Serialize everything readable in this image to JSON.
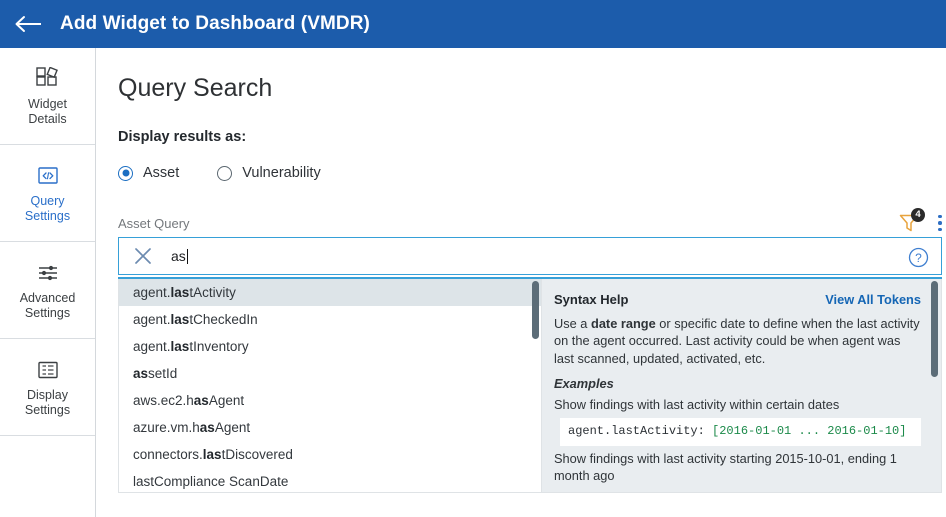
{
  "header": {
    "title": "Add Widget to Dashboard (VMDR)",
    "back_icon": "back-arrow-icon"
  },
  "sidebar": {
    "items": [
      {
        "label": "Widget\nDetails",
        "icon": "widgets-icon",
        "active": false
      },
      {
        "label": "Query\nSettings",
        "icon": "code-icon",
        "active": true
      },
      {
        "label": "Advanced\nSettings",
        "icon": "sliders-icon",
        "active": false
      },
      {
        "label": "Display\nSettings",
        "icon": "display-icon",
        "active": false
      }
    ]
  },
  "main": {
    "page_title": "Query Search",
    "display_results_label": "Display results as:",
    "radios": [
      {
        "label": "Asset",
        "selected": true
      },
      {
        "label": "Vulnerability",
        "selected": false
      }
    ],
    "query_field": {
      "label": "Asset Query",
      "value": "as",
      "clear_icon": "close-x-icon",
      "help_icon": "question-circle-icon",
      "filter_icon": "filter-funnel-icon",
      "filter_badge": "4",
      "menu_icon": "kebab-menu-icon"
    },
    "suggestions": [
      {
        "pre": "agent.",
        "match": "las",
        "post": "tActivity"
      },
      {
        "pre": "agent.",
        "match": "las",
        "post": "tCheckedIn"
      },
      {
        "pre": "agent.",
        "match": "las",
        "post": "tInventory"
      },
      {
        "pre": "",
        "match": "as",
        "post": "setId"
      },
      {
        "pre": "aws.ec2.h",
        "match": "as",
        "post": "Agent"
      },
      {
        "pre": "azure.vm.h",
        "match": "as",
        "post": "Agent"
      },
      {
        "pre": "connectors.",
        "match": "las",
        "post": "tDiscovered"
      },
      {
        "pre": "lastC",
        "match": "",
        "post": "ompliance ScanDate"
      }
    ],
    "help": {
      "title": "Syntax Help",
      "view_all_link": "View All Tokens",
      "description_pre": "Use a ",
      "description_bold": "date range",
      "description_post": " or specific date to define when the last activity on the agent occurred. Last activity could be when agent was last scanned, updated, activated, etc.",
      "examples_heading": "Examples",
      "example_1_text": "Show findings with last activity within certain dates",
      "example_1_code_key": "agent.lastActivity:",
      "example_1_code_val": "[2016-01-01 ... 2016-01-10]",
      "example_2_text": "Show findings with last activity starting 2015-10-01, ending 1 month ago"
    }
  },
  "colors": {
    "header_blue": "#1c5cab",
    "accent_blue": "#2a6fc9",
    "border_blue": "#36a0d8",
    "code_green": "#1c8a4a",
    "filter_orange": "#e8a33d"
  }
}
